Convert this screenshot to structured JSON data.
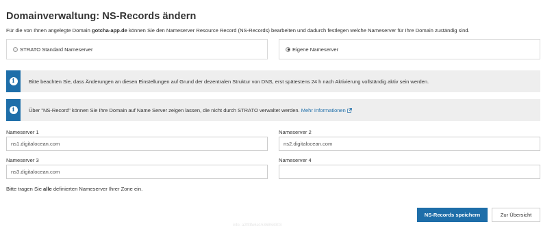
{
  "page": {
    "title": "Domainverwaltung: NS-Records ändern",
    "intro_before": "Für die von Ihnen angelegte Domain ",
    "intro_domain": "gotcha-app.de",
    "intro_after": " können Sie den Nameserver Resource Record (NS-Records) bearbeiten und dadurch festlegen welche Nameserver für Ihre Domain zuständig sind."
  },
  "radio_options": [
    {
      "label": "STRATO Standard Nameserver",
      "checked": false
    },
    {
      "label": "Eigene Nameserver",
      "checked": true
    }
  ],
  "notices": [
    {
      "text": "Bitte beachten Sie, dass Änderungen an diesen Einstellungen auf Grund der dezentralen Struktur von DNS, erst spätestens 24 h nach Aktivierung vollständig aktiv sein werden."
    },
    {
      "text": "Über \"NS-Record\" können Sie Ihre Domain auf Name Server zeigen lassen, die nicht durch STRATO verwaltet werden. ",
      "link": "Mehr Informationen"
    }
  ],
  "nameservers": [
    {
      "label": "Nameserver 1",
      "value": "ns1.digitalocean.com"
    },
    {
      "label": "Nameserver 2",
      "value": "ns2.digitalocean.com"
    },
    {
      "label": "Nameserver 3",
      "value": "ns3.digitalocean.com"
    },
    {
      "label": "Nameserver 4",
      "value": ""
    }
  ],
  "hint": {
    "before": "Bitte tragen Sie ",
    "bold": "alle",
    "after": " definierten Nameserver Ihrer Zone ein."
  },
  "buttons": {
    "save": "NS-Records speichern",
    "overview": "Zur Übersicht"
  },
  "footer": {
    "info": "info: a2ffdfe6e1536858303"
  },
  "colors": {
    "accent": "#1e6ea9",
    "notice_bg": "#eeeeee"
  }
}
